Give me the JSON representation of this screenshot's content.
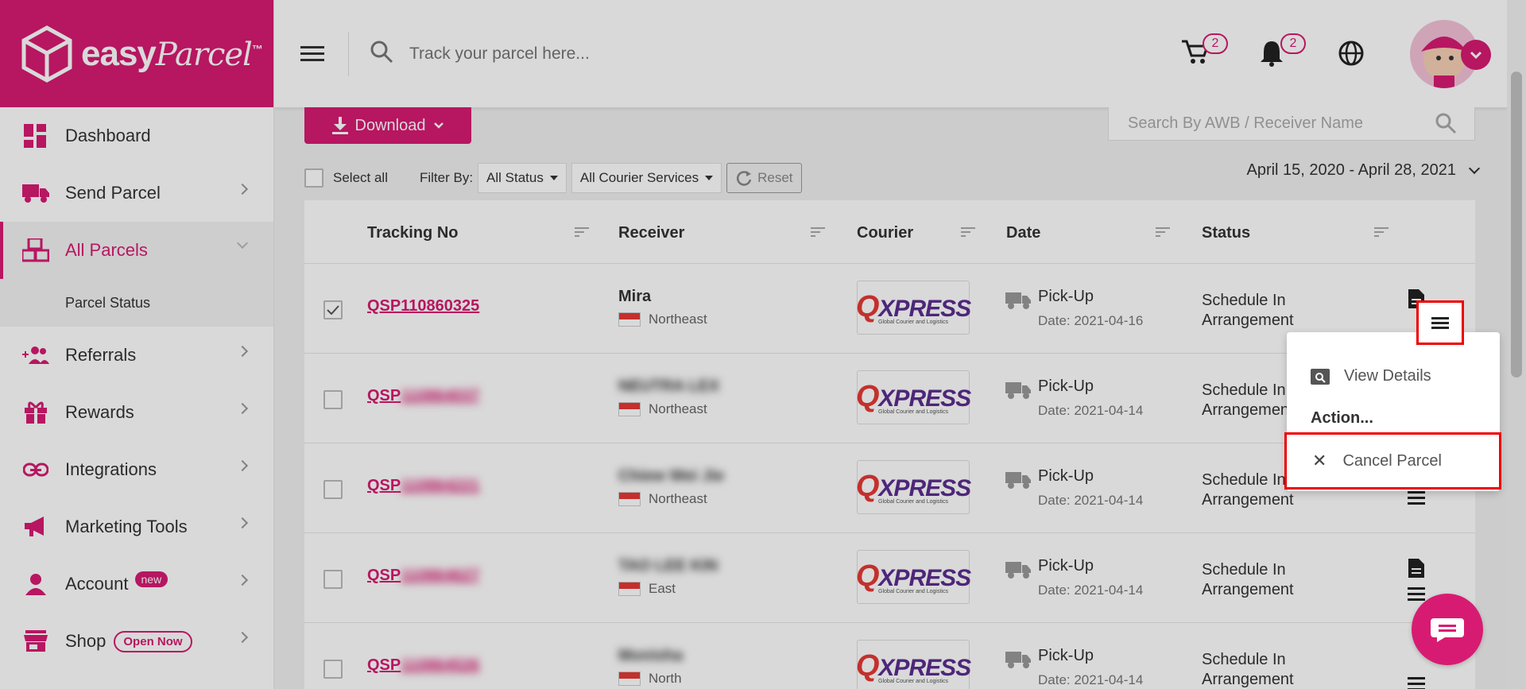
{
  "brand": {
    "logo_text": "easy",
    "logo_script": "Parcel",
    "tm": "™",
    "color": "#d81b72"
  },
  "header": {
    "search_placeholder": "Track your parcel here...",
    "cart_count": "2",
    "notification_count": "2"
  },
  "sidebar": {
    "items": [
      {
        "label": "Dashboard"
      },
      {
        "label": "Send Parcel"
      },
      {
        "label": "All Parcels"
      },
      {
        "label": "Referrals"
      },
      {
        "label": "Rewards"
      },
      {
        "label": "Integrations"
      },
      {
        "label": "Marketing Tools"
      },
      {
        "label": "Account",
        "badge": "new"
      },
      {
        "label": "Shop",
        "badge": "Open Now"
      }
    ],
    "sub_item": "Parcel Status"
  },
  "toolbar": {
    "download_label": "Download",
    "awb_search_placeholder": "Search By AWB / Receiver Name",
    "select_all_label": "Select all",
    "filter_by_label": "Filter By:",
    "status_filter": "All Status",
    "courier_filter": "All Courier Services",
    "reset_label": "Reset",
    "date_range": "April 15, 2020 - April 28, 2021"
  },
  "table": {
    "columns": [
      "Tracking No",
      "Receiver",
      "Courier",
      "Date",
      "Status"
    ],
    "rows": [
      {
        "tracking": "QSP110860325",
        "receiver": "Mira",
        "region": "Northeast",
        "courier": "QXPRESS",
        "type": "Pick-Up",
        "date": "Date: 2021-04-16",
        "status1": "Schedule In",
        "status2": "Arrangement",
        "checked": true
      },
      {
        "tracking": "QSP",
        "tracking_blur": "110864037",
        "receiver": "NEUTRA LEX",
        "region": "Northeast",
        "courier": "QXPRESS",
        "type": "Pick-Up",
        "date": "Date: 2021-04-14",
        "status1": "Schedule In",
        "status2": "Arrangement",
        "checked": false
      },
      {
        "tracking": "QSP",
        "tracking_blur": "110864221",
        "receiver": "Chiew Wei Jie",
        "region": "Northeast",
        "courier": "QXPRESS",
        "type": "Pick-Up",
        "date": "Date: 2021-04-14",
        "status1": "Schedule In",
        "status2": "Arrangement",
        "checked": false
      },
      {
        "tracking": "QSP",
        "tracking_blur": "110864627",
        "receiver": "TAO LEE KIN",
        "region": "East",
        "courier": "QXPRESS",
        "type": "Pick-Up",
        "date": "Date: 2021-04-14",
        "status1": "Schedule In",
        "status2": "Arrangement",
        "checked": false
      },
      {
        "tracking": "QSP",
        "tracking_blur": "110864526",
        "receiver": "Monisha",
        "region": "North",
        "courier": "QXPRESS",
        "type": "Pick-Up",
        "date": "Date: 2021-04-14",
        "status1": "Schedule In",
        "status2": "Arrangement",
        "checked": false
      }
    ]
  },
  "courier_logo_sub": "Global Courier and Logistics",
  "popup": {
    "view_details": "View Details",
    "action_heading": "Action...",
    "cancel_parcel": "Cancel Parcel"
  }
}
